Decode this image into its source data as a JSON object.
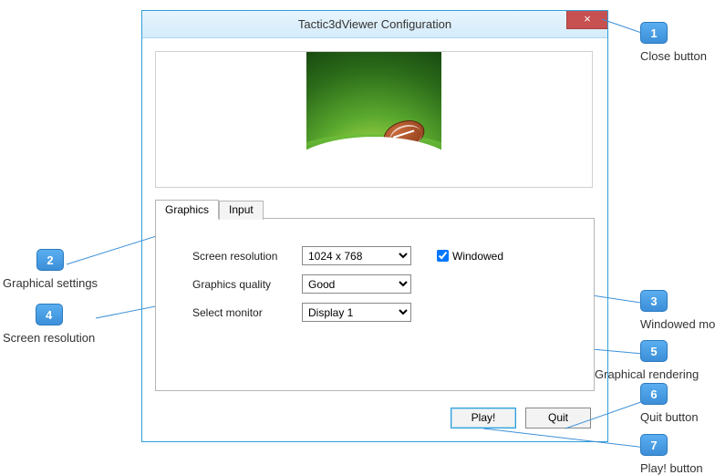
{
  "window": {
    "title": "Tactic3dViewer Configuration",
    "close_char": "×"
  },
  "tabs": {
    "graphics": "Graphics",
    "input": "Input"
  },
  "form": {
    "resolution_label": "Screen resolution",
    "resolution_value": "1024 x 768",
    "quality_label": "Graphics quality",
    "quality_value": "Good",
    "monitor_label": "Select monitor",
    "monitor_value": "Display 1",
    "windowed_label": "Windowed",
    "windowed_checked": true
  },
  "buttons": {
    "play": "Play!",
    "quit": "Quit"
  },
  "callouts": {
    "c1": {
      "num": "1",
      "label": "Close button"
    },
    "c2": {
      "num": "2",
      "label": "Graphical settings"
    },
    "c3": {
      "num": "3",
      "label": "Windowed mode"
    },
    "c4": {
      "num": "4",
      "label": "Screen resolution"
    },
    "c5": {
      "num": "5",
      "label": "Graphical rendering"
    },
    "c6": {
      "num": "6",
      "label": "Quit button"
    },
    "c7": {
      "num": "7",
      "label": "Play! button"
    }
  }
}
